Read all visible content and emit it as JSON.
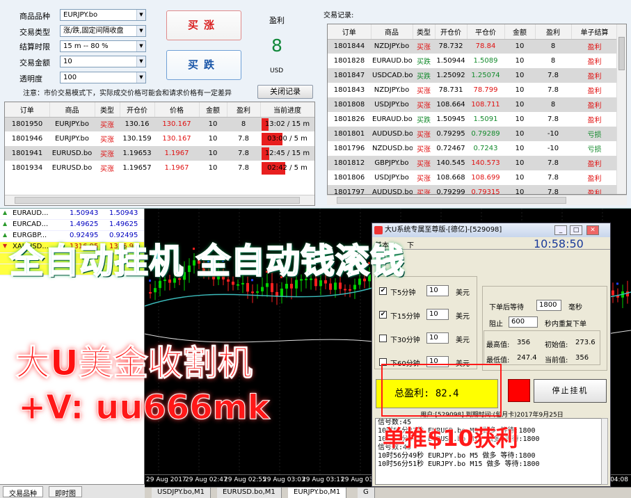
{
  "form": {
    "product_label": "商品品种",
    "product_value": "EURJPY.bo",
    "type_label": "交易类型",
    "type_value": "涨/跌,固定间隔收盘",
    "expiry_label": "结算时限",
    "expiry_value": "15 m -- 80 %",
    "amount_label": "交易金额",
    "amount_value": "10",
    "transparency_label": "透明度",
    "transparency_value": "100"
  },
  "buttons": {
    "buy_up": "买涨",
    "buy_down": "买跌",
    "close_records": "关闭记录"
  },
  "profit": {
    "label": "盈利",
    "value": "8",
    "unit": "USD"
  },
  "notice": "注意：市价交易模式下，实际成交价格可能会和请求价格有一定差异",
  "open_orders": {
    "headers": [
      "订单",
      "商品",
      "类型",
      "开仓价",
      "价格",
      "金额",
      "盈利",
      "当前进度"
    ],
    "rows": [
      {
        "id": "1801950",
        "symbol": "EURJPY.bo",
        "type": "买涨",
        "open": "130.16",
        "price": "130.167",
        "amount": "10",
        "profit": "8",
        "progress_text": "13:02 / 15 m",
        "progress": 0.13
      },
      {
        "id": "1801946",
        "symbol": "EURJPY.bo",
        "type": "买涨",
        "open": "130.159",
        "price": "130.167",
        "amount": "10",
        "profit": "7.8",
        "progress_text": "03:00 / 5 m",
        "progress": 0.4
      },
      {
        "id": "1801941",
        "symbol": "EURUSD.bo",
        "type": "买涨",
        "open": "1.19653",
        "price": "1.1967",
        "amount": "10",
        "profit": "7.8",
        "progress_text": "12:45 / 15 m",
        "progress": 0.15
      },
      {
        "id": "1801934",
        "symbol": "EURUSD.bo",
        "type": "买涨",
        "open": "1.19657",
        "price": "1.1967",
        "amount": "10",
        "profit": "7.8",
        "progress_text": "02:42 / 5 m",
        "progress": 0.46
      }
    ]
  },
  "records": {
    "title": "交易记录:",
    "headers": [
      "订单",
      "商品",
      "类型",
      "开仓价",
      "平仓价",
      "金额",
      "盈利",
      "单子结算"
    ],
    "rows": [
      {
        "id": "1801844",
        "symbol": "NZDJPY.bo",
        "type": "买涨",
        "open": "78.732",
        "close": "78.84",
        "amount": "10",
        "profit": "8",
        "result": "盈利"
      },
      {
        "id": "1801828",
        "symbol": "EURAUD.bo",
        "type": "买跌",
        "open": "1.50944",
        "close": "1.5089",
        "amount": "10",
        "profit": "8",
        "result": "盈利"
      },
      {
        "id": "1801847",
        "symbol": "USDCAD.bo",
        "type": "买跌",
        "open": "1.25092",
        "close": "1.25074",
        "amount": "10",
        "profit": "7.8",
        "result": "盈利"
      },
      {
        "id": "1801843",
        "symbol": "NZDJPY.bo",
        "type": "买涨",
        "open": "78.731",
        "close": "78.799",
        "amount": "10",
        "profit": "7.8",
        "result": "盈利"
      },
      {
        "id": "1801808",
        "symbol": "USDJPY.bo",
        "type": "买涨",
        "open": "108.664",
        "close": "108.711",
        "amount": "10",
        "profit": "8",
        "result": "盈利"
      },
      {
        "id": "1801826",
        "symbol": "EURAUD.bo",
        "type": "买跌",
        "open": "1.50945",
        "close": "1.5091",
        "amount": "10",
        "profit": "7.8",
        "result": "盈利"
      },
      {
        "id": "1801801",
        "symbol": "AUDUSD.bo",
        "type": "买涨",
        "open": "0.79295",
        "close": "0.79289",
        "amount": "10",
        "profit": "-10",
        "result": "亏损"
      },
      {
        "id": "1801796",
        "symbol": "NZDUSD.bo",
        "type": "买涨",
        "open": "0.72467",
        "close": "0.7243",
        "amount": "10",
        "profit": "-10",
        "result": "亏损"
      },
      {
        "id": "1801812",
        "symbol": "GBPJPY.bo",
        "type": "买涨",
        "open": "140.545",
        "close": "140.573",
        "amount": "10",
        "profit": "7.8",
        "result": "盈利"
      },
      {
        "id": "1801806",
        "symbol": "USDJPY.bo",
        "type": "买涨",
        "open": "108.668",
        "close": "108.699",
        "amount": "10",
        "profit": "7.8",
        "result": "盈利"
      },
      {
        "id": "1801797",
        "symbol": "AUDUSD.bo",
        "type": "买涨",
        "open": "0.79299",
        "close": "0.79315",
        "amount": "10",
        "profit": "7.8",
        "result": "盈利"
      }
    ]
  },
  "watchlist": {
    "rows": [
      {
        "symbol": "EURAUD...",
        "bid": "1.50943",
        "ask": "1.50943",
        "dir": "up"
      },
      {
        "symbol": "EURCAD...",
        "bid": "1.49625",
        "ask": "1.49625",
        "dir": "up"
      },
      {
        "symbol": "EURGBP...",
        "bid": "0.92495",
        "ask": "0.92495",
        "dir": "up"
      },
      {
        "symbol": "XAUUSD...",
        "bid": "1316.95",
        "ask": "1316.95",
        "dir": "down"
      }
    ],
    "tabs": [
      "交易品种",
      "即时图"
    ]
  },
  "chart": {
    "time_labels": [
      "29 Aug 2017",
      "29 Aug 02:47",
      "29 Aug 02:55",
      "29 Aug 03:03",
      "29 Aug 03:11",
      "29 Aug 03:19"
    ],
    "corner_time": "04:08",
    "tabs": [
      "USDJPY.bo,M1",
      "EURUSD.bo,M1",
      "EURJPY.bo,M1",
      "G"
    ]
  },
  "system": {
    "title": "大U系统专属至尊版-[德亿]-[529098]",
    "menu": [
      "基本",
      "下"
    ],
    "clock": "10:58:50",
    "options": [
      {
        "label": "下5分钟",
        "value": "10",
        "unit": "美元",
        "checked": true
      },
      {
        "label": "下15分钟",
        "value": "10",
        "unit": "美元",
        "checked": true
      },
      {
        "label": "下30分钟",
        "value": "10",
        "unit": "美元",
        "checked": false
      },
      {
        "label": "下60分钟",
        "value": "10",
        "unit": "美元",
        "checked": false
      }
    ],
    "wait_label": "下单后等待",
    "wait_value": "1800",
    "wait_unit": "毫秒",
    "block_label": "阻止",
    "block_value": "600",
    "block_unit": "秒内重复下单",
    "high_label": "最高值:",
    "high_value": "356",
    "init_label": "初始值:",
    "init_value": "273.6",
    "low_label": "最低值:",
    "low_value": "247.4",
    "current_label": "当前值:",
    "current_value": "356",
    "total_label": "总盈利:",
    "total_value": "82.4",
    "stop_button": "停止挂机",
    "user_line": "用户:[529098] 到期时间:(包月卡)2017年9月25日",
    "log": [
      "信号数:45",
      "10时56分32秒 EURUSD.bo M5 做多 等待:1800",
      "10时56分34秒 EURUSD.bo M15 做多 等待:1800",
      "信号数:45",
      "10时56分49秒 EURJPY.bo M5 做多 等待:1800",
      "10时56分51秒 EURJPY.bo M15 做多 等待:1800"
    ]
  },
  "overlay": {
    "line1": "全自动挂机 全自动钱滚钱",
    "line2": "大U美金收割机",
    "line3": "+V:  uu666mk",
    "line4": "单推$10获利"
  },
  "colors": {
    "red": "#e01010",
    "green": "#138a2c",
    "profit_green": "#11883a",
    "total_bg": "#ffff00",
    "alt_row": "#d9d9d9"
  }
}
